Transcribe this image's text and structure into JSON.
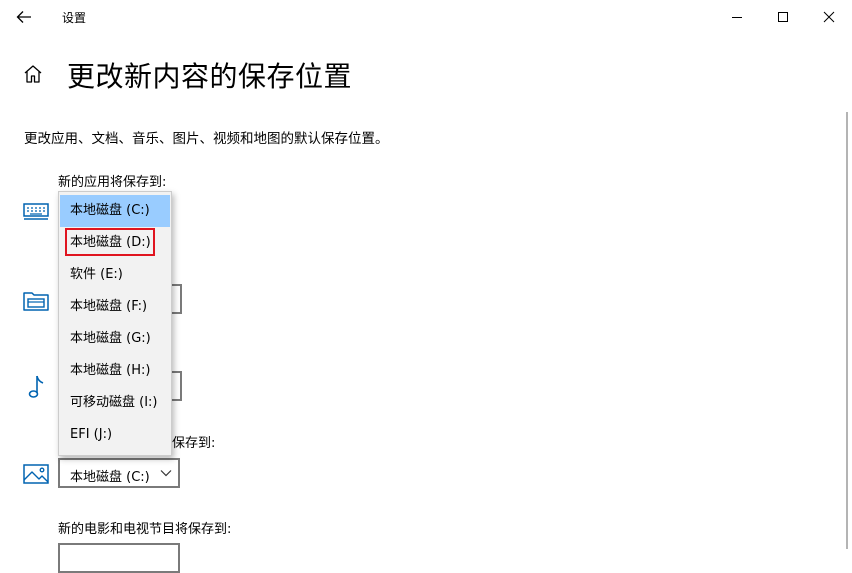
{
  "window": {
    "title": "设置",
    "back_icon": "back-arrow-icon",
    "minimize_icon": "minimize-icon",
    "maximize_icon": "maximize-icon",
    "close_icon": "close-icon"
  },
  "header": {
    "home_icon": "home-icon",
    "title": "更改新内容的保存位置",
    "description": "更改应用、文档、音乐、图片、视频和地图的默认保存位置。"
  },
  "sections": {
    "apps": {
      "label": "新的应用将保存到:",
      "icon": "keyboard-monitor-icon"
    },
    "documents": {
      "icon": "folder-documents-icon"
    },
    "music": {
      "icon": "music-note-icon"
    },
    "photos": {
      "label_visible_part": "保存到:",
      "icon": "picture-icon",
      "selected": "本地磁盘 (C:)"
    },
    "movies": {
      "label": "新的电影和电视节目将保存到:"
    }
  },
  "dropdown": {
    "options": [
      "本地磁盘 (C:)",
      "本地磁盘 (D:)",
      "软件 (E:)",
      "本地磁盘 (F:)",
      "本地磁盘 (G:)",
      "本地磁盘 (H:)",
      "可移动磁盘 (I:)",
      "EFI (J:)"
    ],
    "selected_index": 0,
    "highlighted_index": 1
  },
  "colors": {
    "accent_blue": "#0063b1",
    "selected_bg": "#99ccff",
    "highlight_box": "#e0141f",
    "dropdown_bg": "#f2f2f2",
    "combo_border": "#7a7a7a"
  }
}
